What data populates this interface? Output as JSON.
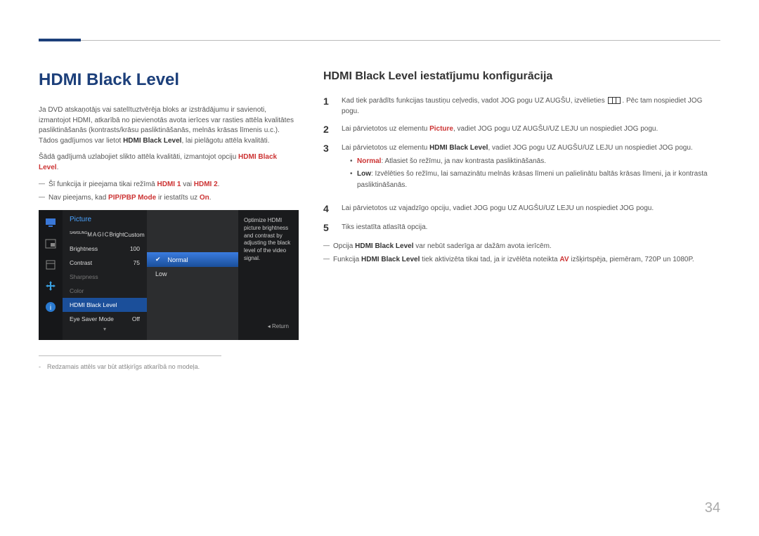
{
  "page_number": "34",
  "left": {
    "h1": "HDMI Black Level",
    "p1a": "Ja DVD atskaņotājs vai satelītuztvērēja bloks ar izstrādājumu ir savienoti, izmantojot HDMI, atkarībā no pievienotās avota ierīces var rasties attēla kvalitātes pasliktināšanās (kontrasts/krāsu pasliktināšanās, melnās krāsas līmenis u.c.). Tādos gadījumos var lietot ",
    "p1b": "HDMI Black Level",
    "p1c": ", lai pielāgotu attēla kvalitāti.",
    "p2a": "Šādā gadījumā uzlabojiet slikto attēla kvalitāti, izmantojot opciju ",
    "p2b": "HDMI Black Level",
    "p2c": ".",
    "note1a": "Šī funkcija ir pieejama tikai režīmā ",
    "note1b": "HDMI 1",
    "note1mid": " vai ",
    "note1c": "HDMI 2",
    "note1d": ".",
    "note2a": "Nav pieejams, kad ",
    "note2b": "PIP/PBP Mode",
    "note2c": " ir iestatīts uz ",
    "note2d": "On",
    "note2e": ".",
    "footnote": "Redzamais attēls var būt atšķirīgs atkarībā no modeļa."
  },
  "osd": {
    "title": "Picture",
    "rows": {
      "magic_label": "MAGIC",
      "magic_suffix": "Bright",
      "magic_val": "Custom",
      "brightness": "Brightness",
      "brightness_val": "100",
      "contrast": "Contrast",
      "contrast_val": "75",
      "sharpness": "Sharpness",
      "color": "Color",
      "hdmibl": "HDMI Black Level",
      "eyesaver": "Eye Saver Mode",
      "eyesaver_val": "Off"
    },
    "options": {
      "normal": "Normal",
      "low": "Low"
    },
    "help": "Optimize HDMI picture brightness and contrast by adjusting the black level of the video signal.",
    "return": "Return"
  },
  "right": {
    "h2": "HDMI Black Level iestatījumu konfigurācija",
    "steps": {
      "s1a": "Kad tiek parādīts funkcijas taustiņu ceļvedis, vadot JOG pogu UZ AUGŠU, izvēlieties ",
      "s1b": ". Pēc tam nospiediet JOG pogu.",
      "s2a": "Lai pārvietotos uz elementu ",
      "s2b": "Picture",
      "s2c": ", vadiet JOG pogu UZ AUGŠU/UZ LEJU un nospiediet JOG pogu.",
      "s3a": "Lai pārvietotos uz elementu ",
      "s3b": "HDMI Black Level",
      "s3c": ", vadiet JOG pogu UZ AUGŠU/UZ LEJU un nospiediet JOG pogu.",
      "bullet_normal_label": "Normal",
      "bullet_normal_text": ": Atlasiet šo režīmu, ja nav kontrasta pasliktināšanās.",
      "bullet_low_label": "Low",
      "bullet_low_text": ": Izvēlēties šo režīmu, lai samazinātu melnās krāsas līmeni un palielinātu baltās krāsas līmeni, ja ir kontrasta pasliktināšanās.",
      "s4": "Lai pārvietotos uz vajadzīgo opciju, vadiet JOG pogu UZ AUGŠU/UZ LEJU un nospiediet JOG pogu.",
      "s5": "Tiks iestatīta atlasītā opcija."
    },
    "foot1a": "Opcija ",
    "foot1b": "HDMI Black Level",
    "foot1c": " var nebūt saderīga ar dažām avota ierīcēm.",
    "foot2a": "Funkcija ",
    "foot2b": "HDMI Black Level",
    "foot2c": " tiek aktivizēta tikai tad, ja ir izvēlēta noteikta ",
    "foot2d": "AV",
    "foot2e": " izšķirtspēja, piemēram, 720P un 1080P."
  }
}
